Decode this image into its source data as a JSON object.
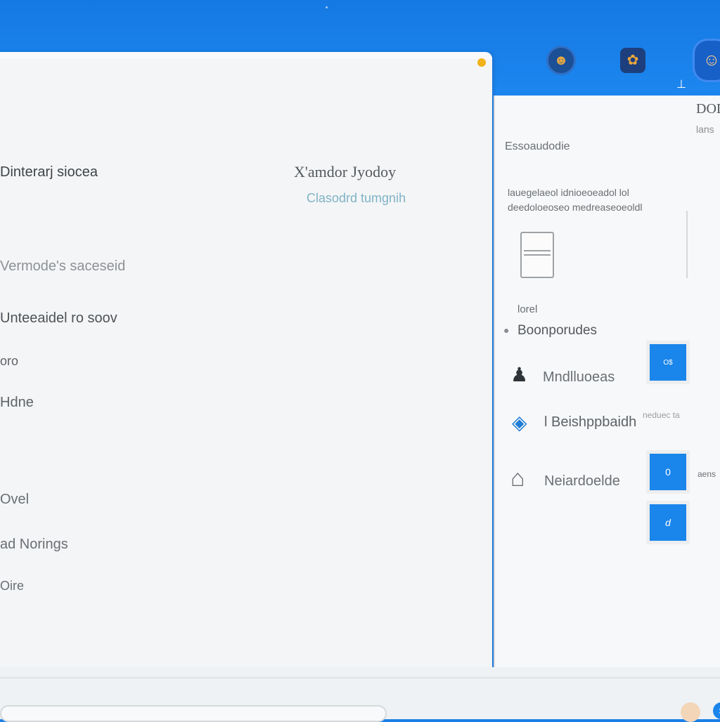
{
  "header": {
    "avatars": [
      "☻",
      "✿",
      "☺"
    ]
  },
  "main": {
    "left_title": "Dinterarj siocea",
    "right_title": "X'amdor Jyodoy",
    "right_subtitle": "Clasodrd tumgnih",
    "nav_items": [
      "Vermode's saceseid",
      "Unteeaidel ro soov",
      "oro",
      "Hdne",
      "Ovel",
      "ad Norings",
      "Oire"
    ]
  },
  "side": {
    "title": "DOD",
    "subtitle": "lans",
    "heading": "Essoaudodie",
    "description_line1": "lauegelaeol idnioeoeadol lol",
    "description_line2": "deedoloeoseo medreaseoeoldl",
    "small_label": "lorel",
    "items": [
      {
        "label": "Boonporudes",
        "icon": "dot-icon"
      },
      {
        "label": "Mndlluoeas",
        "icon": "person-icon"
      },
      {
        "label": "l Beishppbaidh",
        "icon": "badge-icon"
      },
      {
        "label": "Neiardoelde",
        "icon": "pen-icon"
      }
    ],
    "tag_note": "neduec ta",
    "tag_right": "aens",
    "buttons": [
      "O$",
      "0",
      "d"
    ]
  },
  "colors": {
    "accent": "#1a85eb",
    "header": "#1a7fe6",
    "panel": "#f4f5f6",
    "status_dot": "#f1b21a"
  }
}
